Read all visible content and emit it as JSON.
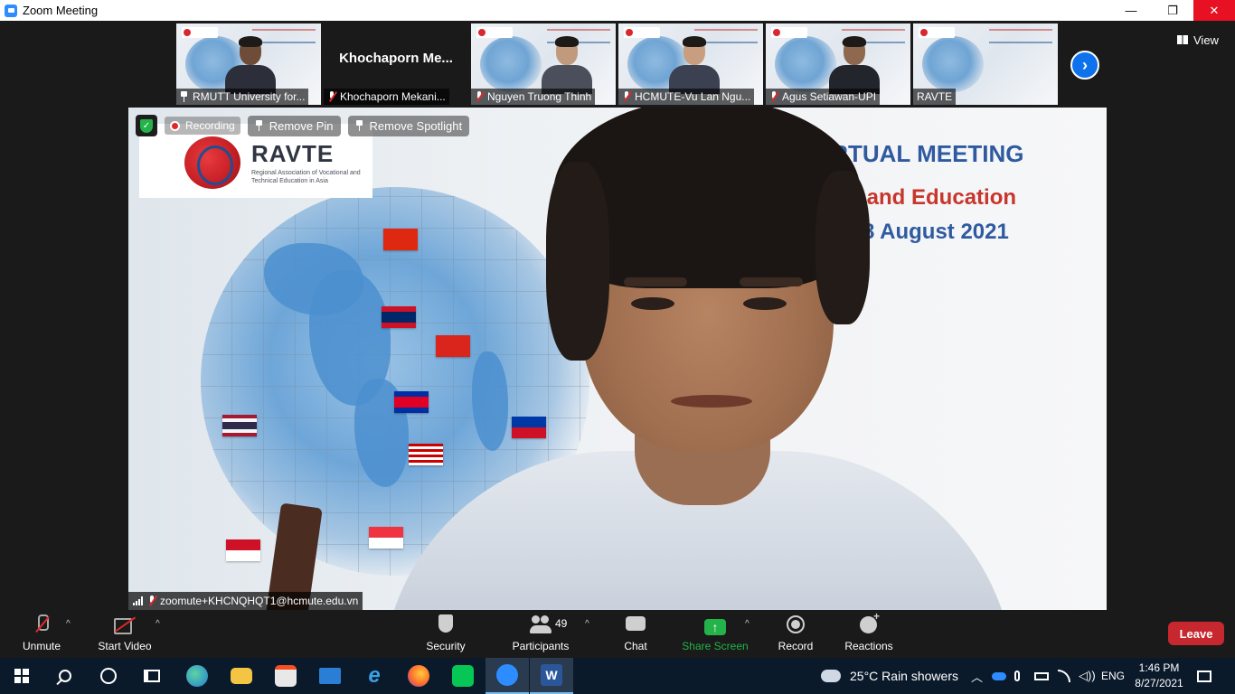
{
  "window": {
    "title": "Zoom Meeting",
    "minimize_glyph": "—",
    "maximize_glyph": "❐",
    "close_glyph": "✕"
  },
  "thumbnails": [
    {
      "name": "RMUTT University for...",
      "pinned": true,
      "video": true
    },
    {
      "name": "Khochaporn Mekani...",
      "display_name": "Khochaporn  Me...",
      "muted": true,
      "video": false
    },
    {
      "name": "Nguyen Truong Thinh",
      "muted": true,
      "video": true
    },
    {
      "name": "HCMUTE-Vu Lan Ngu...",
      "muted": true,
      "video": true
    },
    {
      "name": "Agus Setiawan-UPI",
      "muted": true,
      "video": true
    },
    {
      "name": "RAVTE",
      "video": true
    }
  ],
  "next_page_glyph": "›",
  "view_button": {
    "label": "View"
  },
  "main_video": {
    "recording_label": "Recording",
    "remove_pin_label": "Remove Pin",
    "remove_spotlight_label": "Remove Spotlight",
    "speaker_name": "zoomute+KHCNQHQT1@hcmute.edu.vn",
    "slide_logo_word": "RAVTE",
    "slide_logo_sub": "Regional Association of Vocational and Technical Education in Asia",
    "slide_line1": "IRTUAL MEETING",
    "slide_line2": "gy and Education",
    "slide_line3": "- 28 August 2021"
  },
  "toolbar": {
    "unmute_label": "Unmute",
    "start_video_label": "Start Video",
    "security_label": "Security",
    "participants_label": "Participants",
    "participants_count": "49",
    "chat_label": "Chat",
    "share_screen_label": "Share Screen",
    "record_label": "Record",
    "reactions_label": "Reactions",
    "leave_label": "Leave",
    "caret_glyph": "^"
  },
  "taskbar": {
    "weather": "25°C  Rain showers",
    "language": "ENG",
    "time": "1:46 PM",
    "date": "8/27/2021"
  },
  "colors": {
    "zoom_blue": "#0e72ed",
    "leave_red": "#c7282f",
    "share_green": "#23b34a",
    "close_red": "#e81123"
  }
}
